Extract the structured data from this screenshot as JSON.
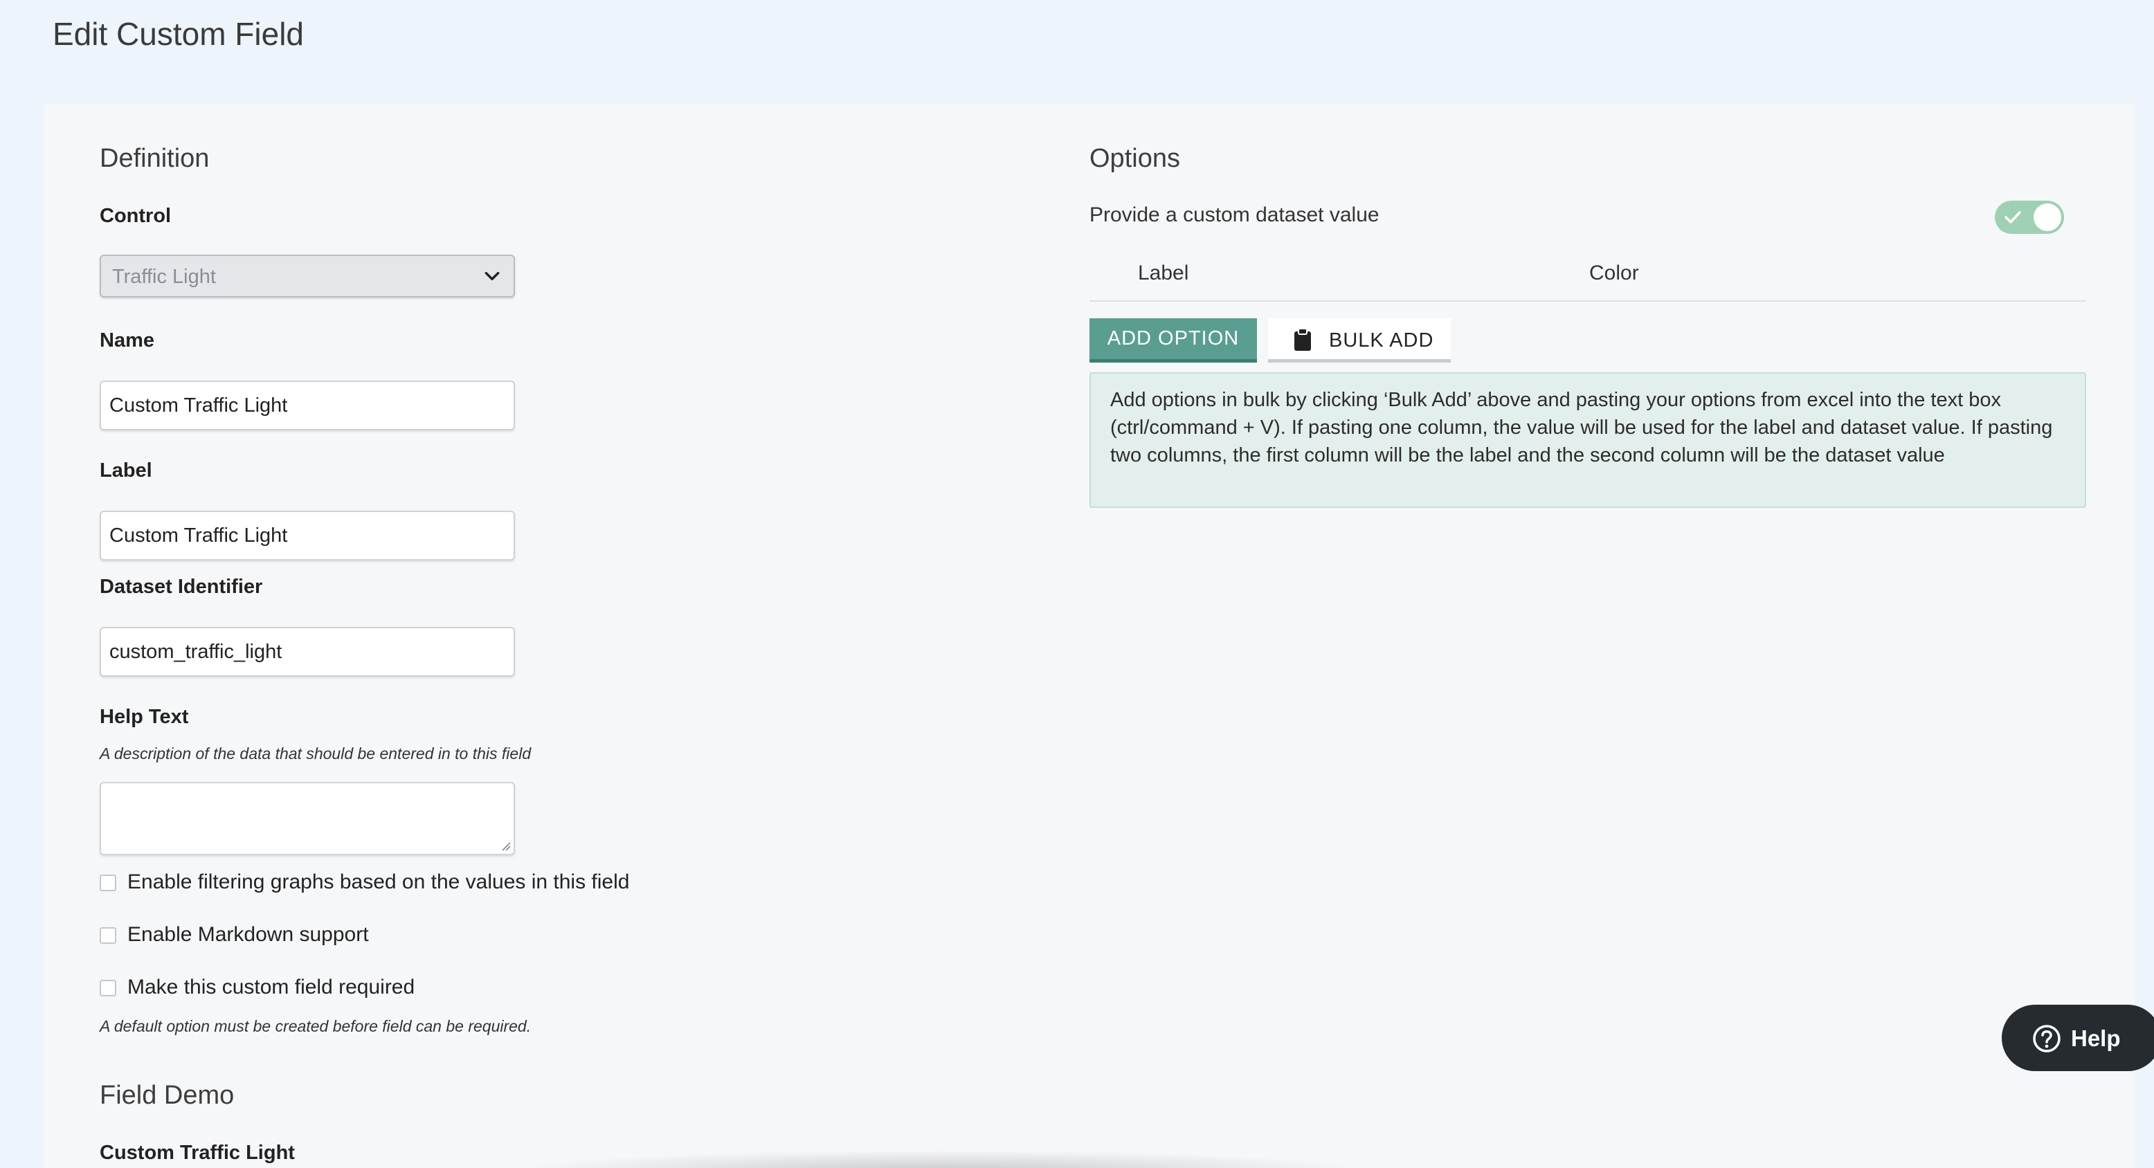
{
  "page": {
    "title": "Edit Custom Field"
  },
  "definition": {
    "title": "Definition",
    "control_label": "Control",
    "control_value": "Traffic Light",
    "name_label": "Name",
    "name_value": "Custom Traffic Light",
    "label_label": "Label",
    "label_value": "Custom Traffic Light",
    "dataset_label": "Dataset Identifier",
    "dataset_value": "custom_traffic_light",
    "help_label": "Help Text",
    "help_hint": "A description of the data that should be entered in to this field",
    "help_value": "",
    "checkboxes": [
      {
        "label": "Enable filtering graphs based on the values in this field",
        "checked": false
      },
      {
        "label": "Enable Markdown support",
        "checked": false
      },
      {
        "label": "Make this custom field required",
        "checked": false
      }
    ],
    "required_hint": "A default option must be created before field can be required."
  },
  "field_demo": {
    "title": "Field Demo",
    "field_label": "Custom Traffic Light"
  },
  "options": {
    "title": "Options",
    "toggle_label": "Provide a custom dataset value",
    "toggle_on": true,
    "columns": [
      "Label",
      "Color"
    ],
    "add_button": "ADD OPTION",
    "bulk_button": "BULK ADD",
    "info": "Add options in bulk by clicking ‘Bulk Add’ above and pasting your options from excel into the text box (ctrl/command + V). If pasting one column, the value will be used for the label and dataset value. If pasting two columns, the first column will be the label and the second column will be the dataset value"
  },
  "help_widget": {
    "label": "Help"
  },
  "colors": {
    "accent": "#5a9e92",
    "toggle_on": "#9fd0b3",
    "info_bg": "#e3efec",
    "help_bg": "#262b30"
  },
  "icons": {
    "select": "chevron-down-icon",
    "bulk": "clipboard-icon",
    "help": "question-circle-icon",
    "toggle": "check-icon"
  }
}
